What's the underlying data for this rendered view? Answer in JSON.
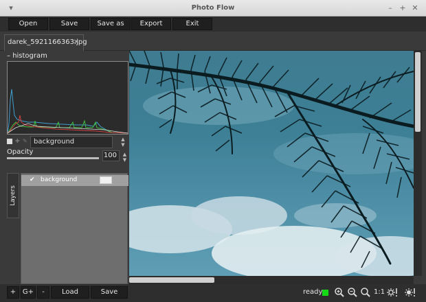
{
  "window": {
    "title": "Photo Flow"
  },
  "toolbar": {
    "buttons": [
      "Open",
      "Save",
      "Save as",
      "Export",
      "Exit"
    ]
  },
  "tabs": [
    {
      "label": "darek_5921166363.jpg",
      "close_icon": "close-icon"
    }
  ],
  "histogram": {
    "title": "histogram",
    "colors": {
      "red": "#d04040",
      "green": "#40c040",
      "blue": "#40a0d0",
      "white": "#e0e0e0"
    }
  },
  "layer_controls": {
    "layer_name": "background",
    "opacity_label": "Opacity",
    "opacity_value": "100",
    "opacity_fraction": 1.0
  },
  "layers_panel": {
    "tab_label": "Layers",
    "items": [
      {
        "name": "background",
        "checked": true
      }
    ]
  },
  "bottom_bar": {
    "buttons": [
      "+",
      "G+",
      "-",
      "Load",
      "Save"
    ],
    "status": "ready",
    "status_color": "#15d915",
    "zoom_1to1": "1:1"
  }
}
